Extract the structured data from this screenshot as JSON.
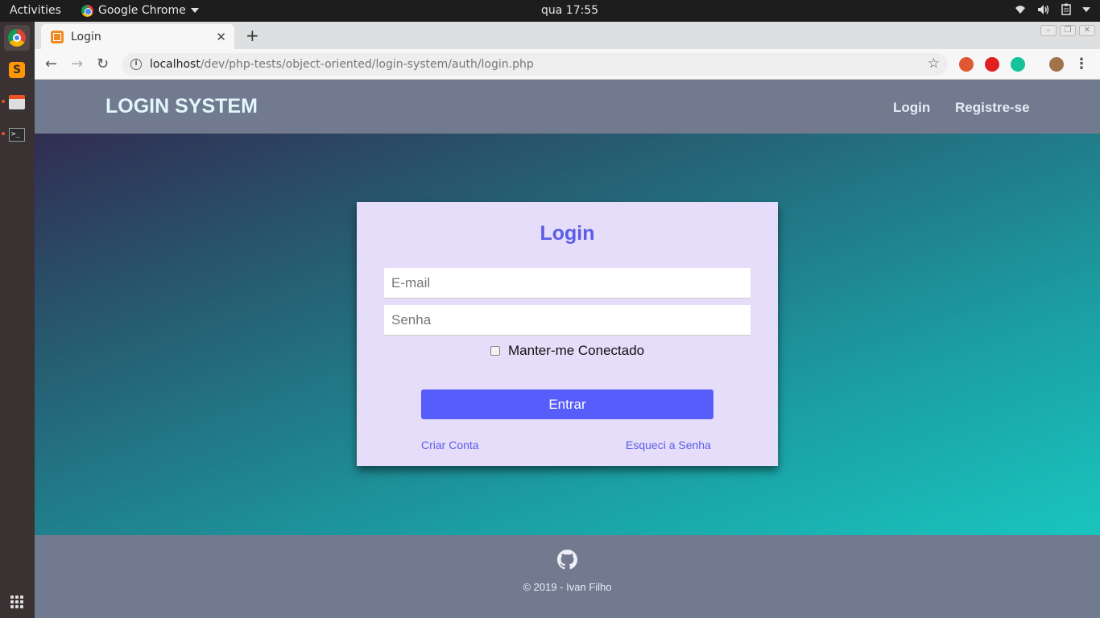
{
  "system": {
    "activities": "Activities",
    "app_name": "Google Chrome",
    "clock": "qua 17:55"
  },
  "browser": {
    "tab_title": "Login",
    "url_host": "localhost",
    "url_path": "/dev/php-tests/object-oriented/login-system/auth/login.php"
  },
  "site": {
    "brand": "LOGIN SYSTEM",
    "nav": {
      "login": "Login",
      "register": "Registre-se"
    }
  },
  "login_form": {
    "title": "Login",
    "email_placeholder": "E-mail",
    "password_placeholder": "Senha",
    "remember_label": "Manter-me Conectado",
    "submit_label": "Entrar",
    "create_account": "Criar Conta",
    "forgot_password": "Esqueci a Senha"
  },
  "footer": {
    "icon": "github-icon",
    "copyright": "© 2019 - Ivan Filho"
  },
  "colors": {
    "header_bg": "#717a8f",
    "accent": "#575dfa",
    "card_bg": "#e5ddf9",
    "brand_text": "#e2f7fb"
  }
}
